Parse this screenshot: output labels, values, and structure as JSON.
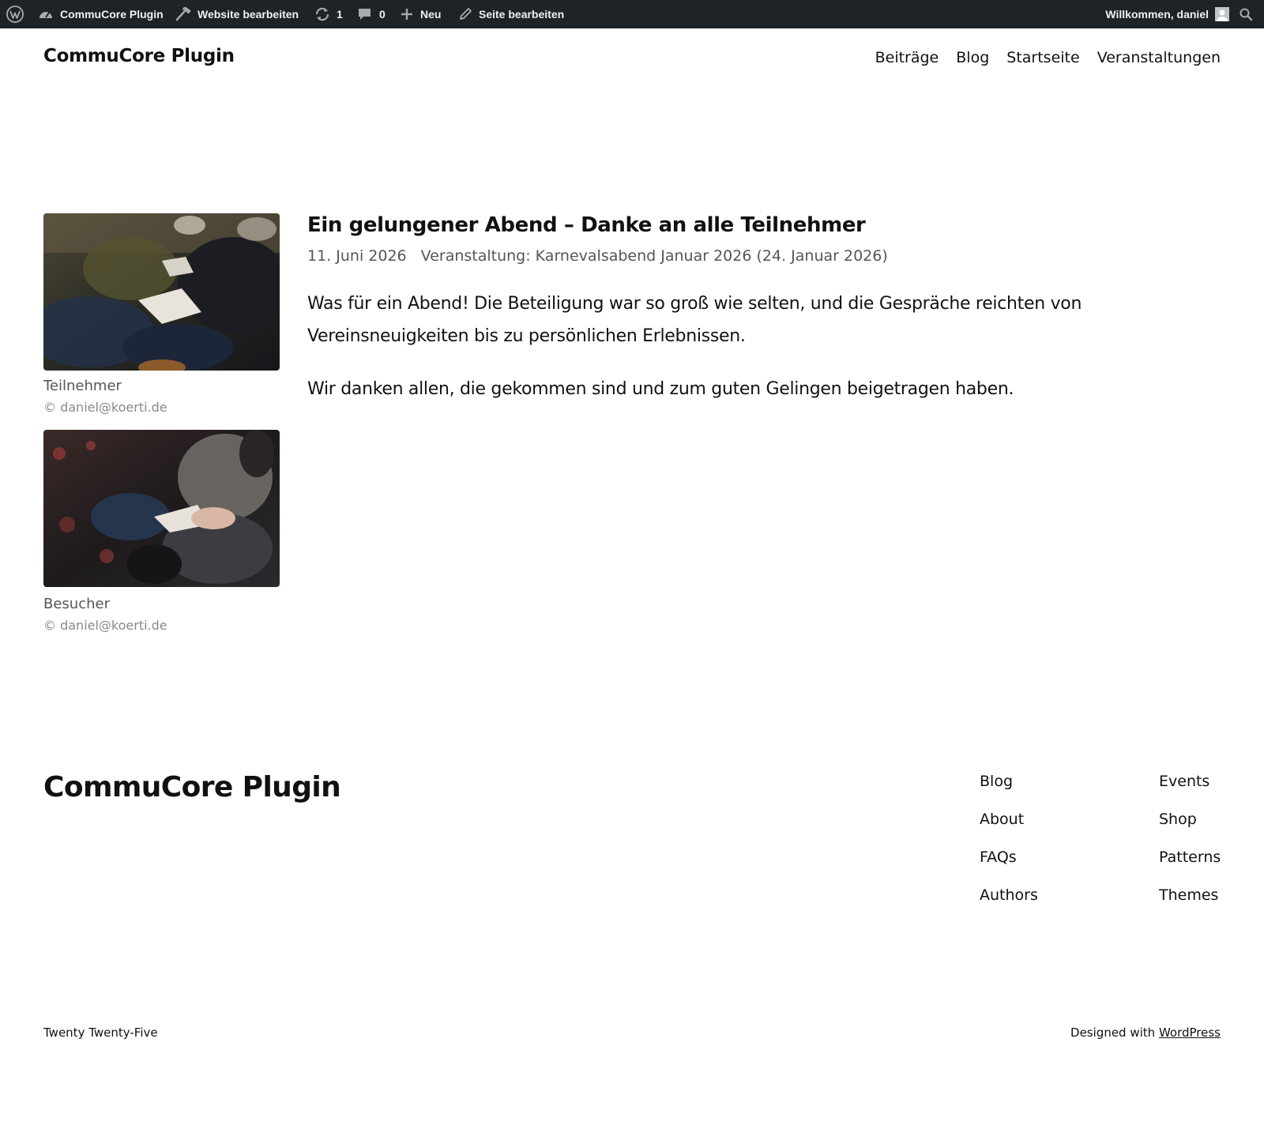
{
  "admin_bar": {
    "site_name": "CommuCore Plugin",
    "edit_site": "Website bearbeiten",
    "updates_count": "1",
    "comments_count": "0",
    "new_label": "Neu",
    "edit_page": "Seite bearbeiten",
    "welcome": "Willkommen, daniel",
    "icons": [
      "wordpress-logo-icon",
      "dashboard-icon",
      "hammer-icon",
      "updates-icon",
      "comment-icon",
      "plus-icon",
      "pencil-icon",
      "avatar",
      "search-icon"
    ],
    "background_color": "#1d2327"
  },
  "header": {
    "site_title": "CommuCore Plugin",
    "nav": [
      "Beiträge",
      "Blog",
      "Startseite",
      "Veranstaltungen"
    ]
  },
  "gallery": [
    {
      "caption": "Teilnehmer",
      "credit": "© daniel@koerti.de"
    },
    {
      "caption": "Besucher",
      "credit": "© daniel@koerti.de"
    }
  ],
  "post": {
    "title": "Ein gelungener Abend – Danke an alle Teilnehmer",
    "date": "11. Juni 2026",
    "event": "Veranstaltung: Karnevalsabend Januar 2026 (24. Januar 2026)",
    "paragraphs": [
      "Was für ein Abend! Die Beteiligung war so groß wie selten, und die Gespräche reichten von Vereinsneuigkeiten bis zu persönlichen Erlebnissen.",
      "Wir danken allen, die gekommen sind und zum guten Gelingen beigetragen haben."
    ]
  },
  "footer": {
    "site_title": "CommuCore Plugin",
    "links_left": [
      "Blog",
      "About",
      "FAQs",
      "Authors"
    ],
    "links_right": [
      "Events",
      "Shop",
      "Patterns",
      "Themes"
    ],
    "theme_name": "Twenty Twenty-Five",
    "designed_with": "Designed with",
    "wordpress_link": "WordPress"
  }
}
